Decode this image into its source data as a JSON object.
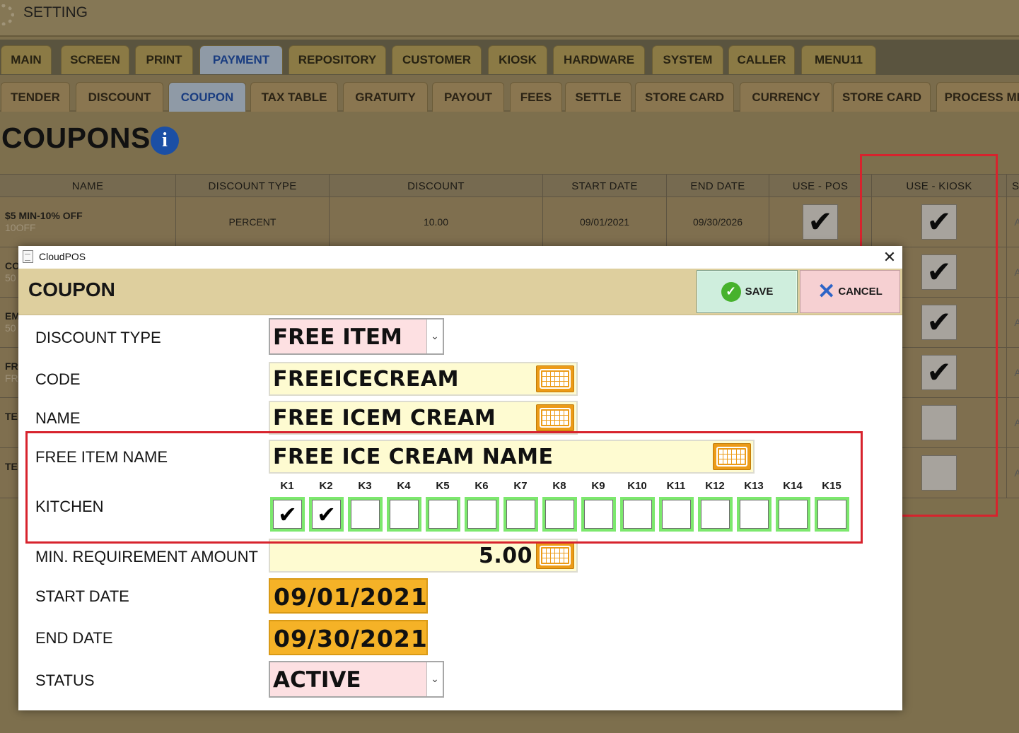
{
  "app": {
    "title": "SETTING"
  },
  "main_tabs": [
    "MAIN",
    "SCREEN",
    "PRINT",
    "PAYMENT",
    "REPOSITORY",
    "CUSTOMER",
    "KIOSK",
    "HARDWARE",
    "SYSTEM",
    "CALLER",
    "MENU11"
  ],
  "main_tabs_active": "PAYMENT",
  "sub_tabs": [
    "TENDER",
    "DISCOUNT",
    "COUPON",
    "TAX TABLE",
    "GRATUITY",
    "PAYOUT",
    "FEES",
    "SETTLE",
    "STORE CARD",
    "CURRENCY",
    "STORE CARD",
    "PROCESS MI"
  ],
  "sub_tabs_active": "COUPON",
  "page": {
    "heading": "COUPONS",
    "info_icon_glyph": "i"
  },
  "table": {
    "columns": [
      "NAME",
      "DISCOUNT TYPE",
      "DISCOUNT",
      "START DATE",
      "END DATE",
      "USE - POS",
      "USE - KIOSK",
      "S"
    ],
    "rows": [
      {
        "name": "$5 MIN-10% OFF",
        "code": "10OFF",
        "type": "PERCENT",
        "discount": "10.00",
        "start": "09/01/2021",
        "end": "09/30/2026",
        "pos": true,
        "kiosk": true,
        "trail": "A"
      },
      {
        "name": "CO",
        "code": "50",
        "kiosk": true,
        "trail": "A"
      },
      {
        "name": "EM",
        "code": "50",
        "kiosk": true,
        "trail": "A"
      },
      {
        "name": "FR",
        "code": "FR",
        "kiosk": true,
        "trail": "A"
      },
      {
        "name": "TE",
        "code": "",
        "kiosk": false,
        "trail": "A"
      },
      {
        "name": "TE",
        "code": "",
        "kiosk": false,
        "trail": "A"
      }
    ],
    "check_glyph": "✔"
  },
  "dialog": {
    "app_name": "CloudPOS",
    "close_glyph": "✕",
    "heading": "COUPON",
    "save_label": "SAVE",
    "cancel_label": "CANCEL",
    "fields": {
      "discount_type": {
        "label": "DISCOUNT TYPE",
        "value": "FREE ITEM"
      },
      "code": {
        "label": "CODE",
        "value": "FREEICECREAM"
      },
      "name": {
        "label": "NAME",
        "value": "FREE ICEM CREAM"
      },
      "free_item_name": {
        "label": "FREE ITEM NAME",
        "value": "FREE ICE CREAM NAME"
      },
      "kitchen": {
        "label": "KITCHEN"
      },
      "min_amount": {
        "label": "MIN. REQUIREMENT AMOUNT",
        "value": "5.00"
      },
      "start_date": {
        "label": "START DATE",
        "value": "09/01/2021"
      },
      "end_date": {
        "label": "END DATE",
        "value": "09/30/2021"
      },
      "status": {
        "label": "STATUS",
        "value": "ACTIVE"
      }
    },
    "kitchens": [
      {
        "label": "K1",
        "checked": true
      },
      {
        "label": "K2",
        "checked": true
      },
      {
        "label": "K3",
        "checked": false
      },
      {
        "label": "K4",
        "checked": false
      },
      {
        "label": "K5",
        "checked": false
      },
      {
        "label": "K6",
        "checked": false
      },
      {
        "label": "K7",
        "checked": false
      },
      {
        "label": "K8",
        "checked": false
      },
      {
        "label": "K9",
        "checked": false
      },
      {
        "label": "K10",
        "checked": false
      },
      {
        "label": "K11",
        "checked": false
      },
      {
        "label": "K12",
        "checked": false
      },
      {
        "label": "K13",
        "checked": false
      },
      {
        "label": "K14",
        "checked": false
      },
      {
        "label": "K15",
        "checked": false
      }
    ],
    "kitchen_check_glyph": "✔",
    "dropdown_glyph": "⌄"
  },
  "colors": {
    "highlight_red": "#d7232d",
    "kitchen_border_green": "#7ce86d",
    "date_orange": "#f5b227",
    "keyboard_orange": "#ec9b18"
  },
  "icons": {
    "settings": "gear-icon",
    "info": "info-icon",
    "document": "document-icon",
    "save": "checkmark-circle-icon",
    "cancel": "x-icon",
    "keyboard": "keyboard-icon"
  }
}
